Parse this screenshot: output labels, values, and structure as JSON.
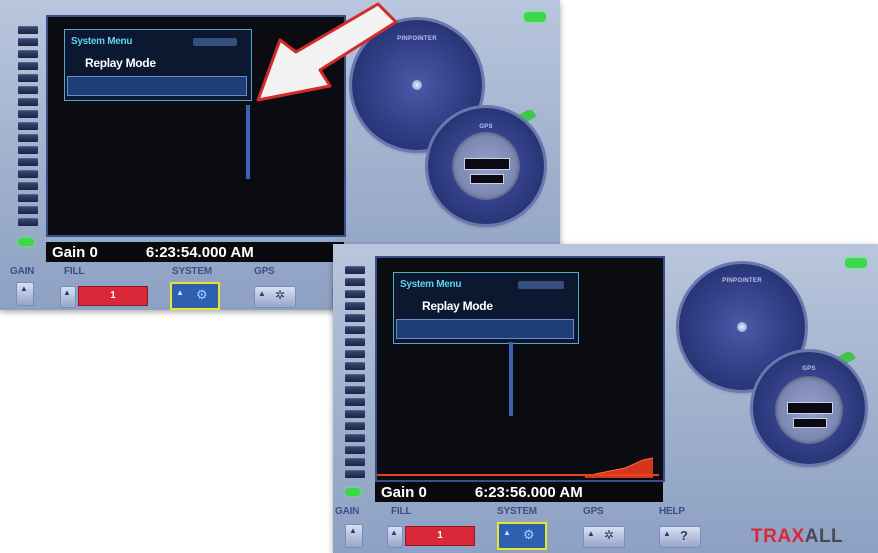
{
  "screens": [
    {
      "menu_title": "System Menu",
      "menu_item": "Replay Mode",
      "gain_text": "Gain 0",
      "time_text": "6:23:54.000 AM",
      "toolbar": {
        "gain": "GAIN",
        "fill": "FILL",
        "system": "SYSTEM",
        "gps": "GPS"
      },
      "fill_value": "1",
      "dial_labels": {
        "pinpointer": "PINPOINTER",
        "gps": "GPS"
      }
    },
    {
      "menu_title": "System Menu",
      "menu_item": "Replay Mode",
      "gain_text": "Gain 0",
      "time_text": "6:23:56.000 AM",
      "toolbar": {
        "gain": "GAIN",
        "fill": "FILL",
        "system": "SYSTEM",
        "gps": "GPS",
        "help": "HELP"
      },
      "fill_value": "1",
      "dial_labels": {
        "pinpointer": "PINPOINTER",
        "gps": "GPS"
      }
    }
  ],
  "logo": {
    "part1": "TRAX",
    "part2": "ALL"
  },
  "colors": {
    "arrow": "#d42a2a",
    "accent_red": "#d8283a",
    "led_green": "#3cd84a",
    "select_yellow": "#e5e82a"
  },
  "icons": {
    "arrow": "pointer-arrow",
    "gear": "gear-icon",
    "gps_tool": "satellite-icon",
    "help": "question-icon"
  }
}
